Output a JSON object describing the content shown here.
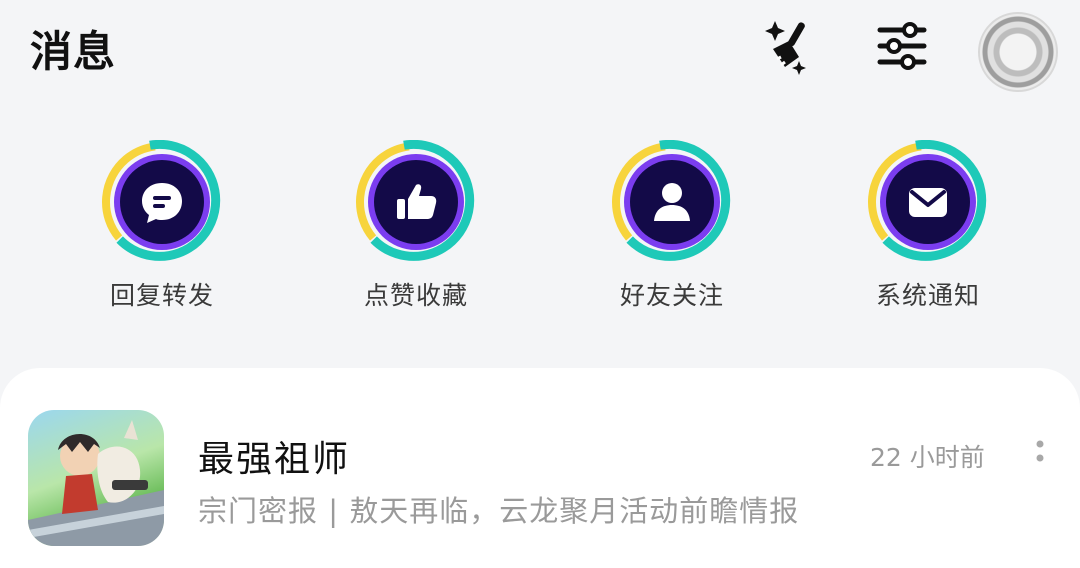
{
  "header": {
    "title": "消息",
    "actions": [
      {
        "icon": "broom-sparkle-icon"
      },
      {
        "icon": "filter-sliders-icon"
      },
      {
        "icon": "avatar"
      }
    ]
  },
  "quick_actions": [
    {
      "label": "回复转发",
      "icon": "chat-bubble-icon"
    },
    {
      "label": "点赞收藏",
      "icon": "thumbs-up-icon"
    },
    {
      "label": "好友关注",
      "icon": "person-icon"
    },
    {
      "label": "系统通知",
      "icon": "envelope-icon"
    }
  ],
  "colors": {
    "ring_teal": "#1ec9b8",
    "ring_yellow": "#f7d43c",
    "ring_purple": "#7b3df0",
    "icon_bg": "#130a48"
  },
  "messages": [
    {
      "title": "最强祖师",
      "time": "22 小时前",
      "subtitle": "宗门密报 | 敖天再临，云龙聚月活动前瞻情报"
    }
  ]
}
